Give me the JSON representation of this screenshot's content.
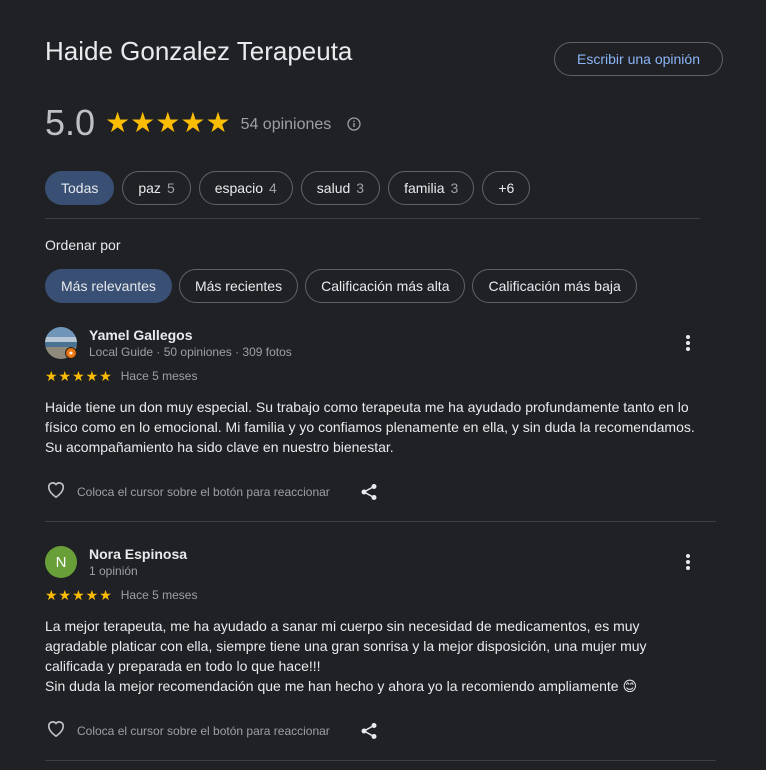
{
  "header": {
    "title": "Haide Gonzalez Terapeuta",
    "write_review_label": "Escribir una opinión"
  },
  "summary": {
    "rating": "5.0",
    "stars_value": 5,
    "count_label": "54 opiniones"
  },
  "topics": [
    {
      "label": "Todas",
      "count": "",
      "selected": true
    },
    {
      "label": "paz",
      "count": "5"
    },
    {
      "label": "espacio",
      "count": "4"
    },
    {
      "label": "salud",
      "count": "3"
    },
    {
      "label": "familia",
      "count": "3"
    },
    {
      "label": "+6",
      "count": ""
    }
  ],
  "sort": {
    "label": "Ordenar por",
    "options": [
      {
        "label": "Más relevantes",
        "selected": true
      },
      {
        "label": "Más recientes"
      },
      {
        "label": "Calificación más alta"
      },
      {
        "label": "Calificación más baja"
      }
    ]
  },
  "reviews": [
    {
      "name": "Yamel Gallegos",
      "meta": "Local Guide · 50 opiniones · 309 fotos",
      "avatar": "landscape-photo",
      "local_guide": true,
      "stars_value": 5,
      "when": "Hace 5 meses",
      "text": "Haide tiene un don muy especial. Su trabajo como terapeuta me ha ayudado profundamente tanto en lo físico como en lo emocional. Mi familia y yo confiamos plenamente en ella, y sin duda la recomendamos. Su acompañamiento ha sido clave en nuestro bienestar.",
      "react_label": "Coloca el cursor sobre el botón para reaccionar"
    },
    {
      "name": "Nora Espinosa",
      "meta": "1 opinión",
      "avatar_letter": "N",
      "avatar_color": "#689f38",
      "stars_value": 5,
      "when": "Hace 5 meses",
      "text": "La mejor terapeuta, me ha ayudado a sanar mi cuerpo sin necesidad de medicamentos, es muy agradable platicar con ella, siempre tiene una gran sonrisa y la mejor disposición, una mujer muy calificada y preparada en todo lo que hace!!!\nSin duda la mejor recomendación que me han hecho y ahora yo la recomiendo ampliamente 😊",
      "react_label": "Coloca el cursor sobre el botón para reaccionar"
    }
  ],
  "colors": {
    "background": "#202124",
    "star": "#fbbc04",
    "link": "#8ab4f8",
    "selected_chip": "#394f73"
  }
}
